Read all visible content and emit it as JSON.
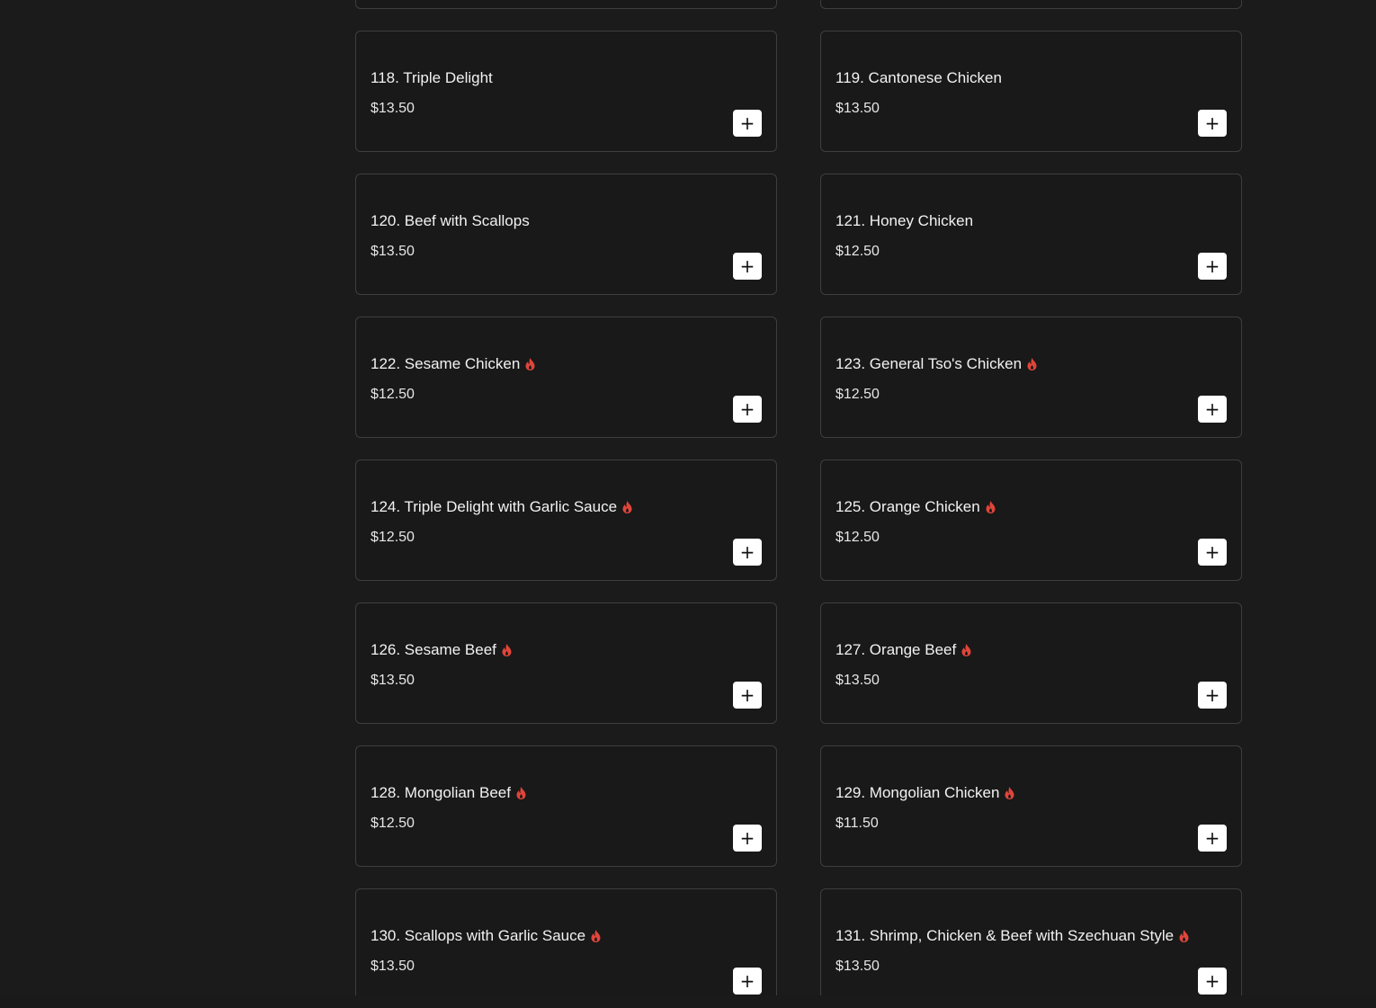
{
  "add_button_label": "+",
  "spicy_color": "#e0453a",
  "menu_items": [
    {
      "name": "",
      "price": "",
      "spicy": false
    },
    {
      "name": "",
      "price": "",
      "spicy": false
    },
    {
      "name": "118. Triple Delight",
      "price": "$13.50",
      "spicy": false
    },
    {
      "name": "119. Cantonese Chicken",
      "price": "$13.50",
      "spicy": false
    },
    {
      "name": "120. Beef with Scallops",
      "price": "$13.50",
      "spicy": false
    },
    {
      "name": "121. Honey Chicken",
      "price": "$12.50",
      "spicy": false
    },
    {
      "name": "122. Sesame Chicken",
      "price": "$12.50",
      "spicy": true
    },
    {
      "name": "123. General Tso's Chicken",
      "price": "$12.50",
      "spicy": true
    },
    {
      "name": "124. Triple Delight with Garlic Sauce",
      "price": "$12.50",
      "spicy": true
    },
    {
      "name": "125. Orange Chicken",
      "price": "$12.50",
      "spicy": true
    },
    {
      "name": "126. Sesame Beef",
      "price": "$13.50",
      "spicy": true
    },
    {
      "name": "127. Orange Beef",
      "price": "$13.50",
      "spicy": true
    },
    {
      "name": "128. Mongolian Beef",
      "price": "$12.50",
      "spicy": true
    },
    {
      "name": "129. Mongolian Chicken",
      "price": "$11.50",
      "spicy": true
    },
    {
      "name": "130. Scallops with Garlic Sauce",
      "price": "$13.50",
      "spicy": true
    },
    {
      "name": "131. Shrimp, Chicken & Beef with Szechuan Style",
      "price": "$13.50",
      "spicy": true
    }
  ]
}
